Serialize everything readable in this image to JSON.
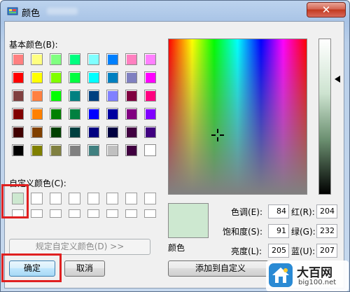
{
  "window": {
    "title": "颜色",
    "close_glyph": "✕"
  },
  "basic_colors": {
    "label": "基本颜色(B):",
    "rows": [
      [
        "#ff8080",
        "#ffff80",
        "#80ff80",
        "#00ff80",
        "#80ffff",
        "#0080ff",
        "#ff80c0",
        "#ff80ff"
      ],
      [
        "#ff0000",
        "#ffff00",
        "#80ff00",
        "#00ff40",
        "#00ffff",
        "#0080c0",
        "#8080c0",
        "#ff00ff"
      ],
      [
        "#804040",
        "#ff8040",
        "#00ff00",
        "#008080",
        "#004080",
        "#8080ff",
        "#800040",
        "#ff0080"
      ],
      [
        "#800000",
        "#ff8000",
        "#008000",
        "#008040",
        "#0000ff",
        "#0000a0",
        "#800080",
        "#8000ff"
      ],
      [
        "#400000",
        "#804000",
        "#004000",
        "#004040",
        "#000080",
        "#000040",
        "#400040",
        "#400080"
      ],
      [
        "#000000",
        "#808000",
        "#808040",
        "#808080",
        "#408080",
        "#c0c0c0",
        "#400040",
        "#ffffff"
      ]
    ]
  },
  "custom_colors": {
    "label": "自定义颜色(C):",
    "selected_color": "#cde8d0",
    "empty_color": "#ffffff"
  },
  "buttons": {
    "define_custom": "规定自定义颜色(D) >>",
    "ok": "确定",
    "cancel": "取消",
    "add_to_custom": "添加到自定义"
  },
  "color_solid_label": "颜色",
  "fields": {
    "hue": {
      "label": "色调(E):",
      "value": "84"
    },
    "sat": {
      "label": "饱和度(S):",
      "value": "91"
    },
    "lum": {
      "label": "亮度(L):",
      "value": "205"
    },
    "red": {
      "label": "红(R):",
      "value": "204"
    },
    "green": {
      "label": "绿(G):",
      "value": "232"
    },
    "blue": {
      "label": "蓝(U):",
      "value": "207"
    }
  },
  "highlight_color": "#e02020",
  "watermark": {
    "title": "大百网",
    "url": "big100.net"
  }
}
